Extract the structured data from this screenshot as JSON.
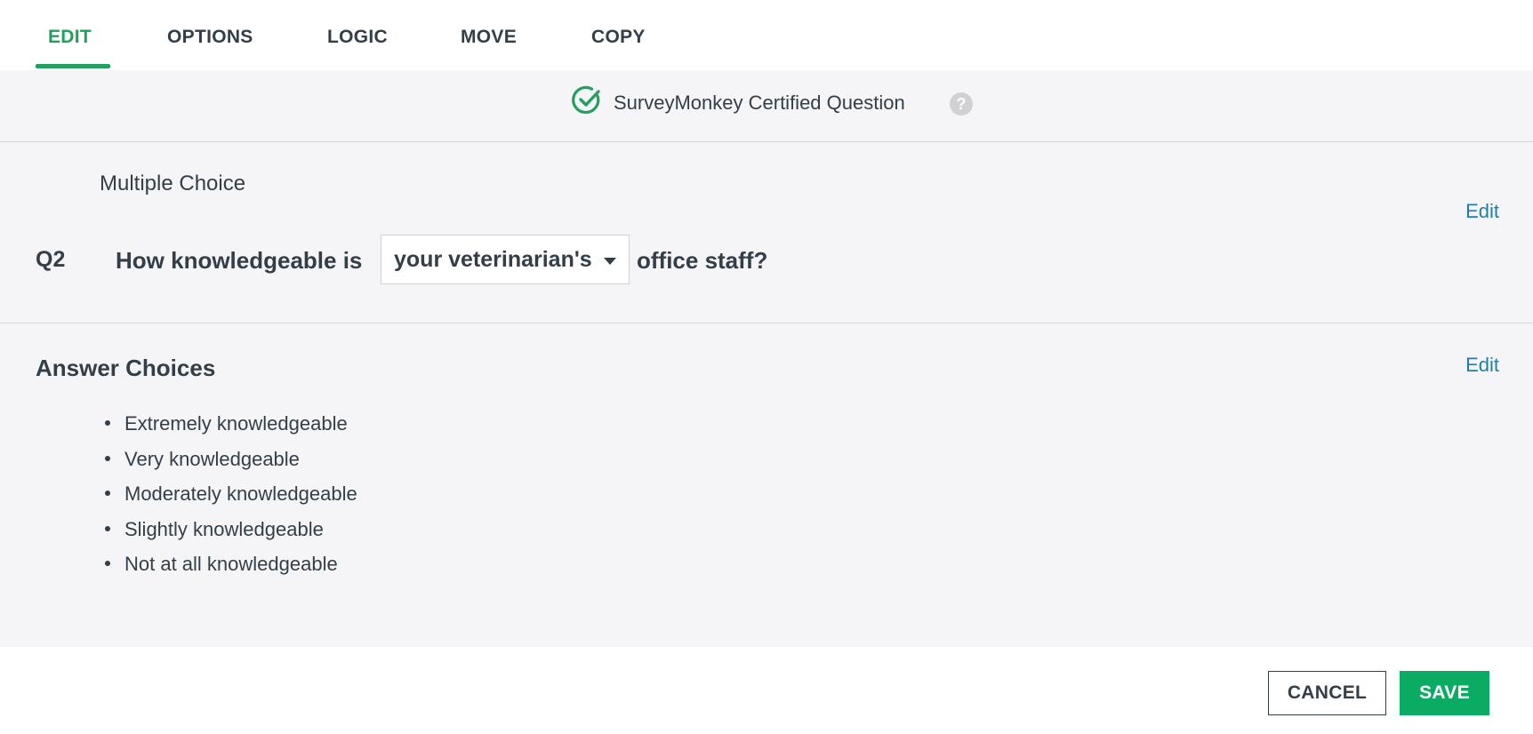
{
  "tabs": [
    {
      "label": "EDIT",
      "active": true
    },
    {
      "label": "OPTIONS",
      "active": false
    },
    {
      "label": "LOGIC",
      "active": false
    },
    {
      "label": "MOVE",
      "active": false
    },
    {
      "label": "COPY",
      "active": false
    }
  ],
  "certified": {
    "icon": "check-circle-icon",
    "text": "SurveyMonkey Certified Question",
    "help_icon": "question-mark-icon",
    "help_glyph": "?"
  },
  "question": {
    "type": "Multiple Choice",
    "number": "Q2",
    "text_before": "How knowledgeable is",
    "pipe_value": "your veterinarian's",
    "text_after": "office staff?",
    "edit_label": "Edit"
  },
  "answers": {
    "title": "Answer Choices",
    "edit_label": "Edit",
    "items": [
      "Extremely knowledgeable",
      "Very knowledgeable",
      "Moderately knowledgeable",
      "Slightly knowledgeable",
      "Not at all knowledgeable"
    ]
  },
  "footer": {
    "cancel_label": "CANCEL",
    "save_label": "SAVE"
  },
  "colors": {
    "accent": "#21a05e",
    "save_button": "#0aab62",
    "link": "#1e7fa9",
    "panel_bg": "#f5f5f7"
  }
}
